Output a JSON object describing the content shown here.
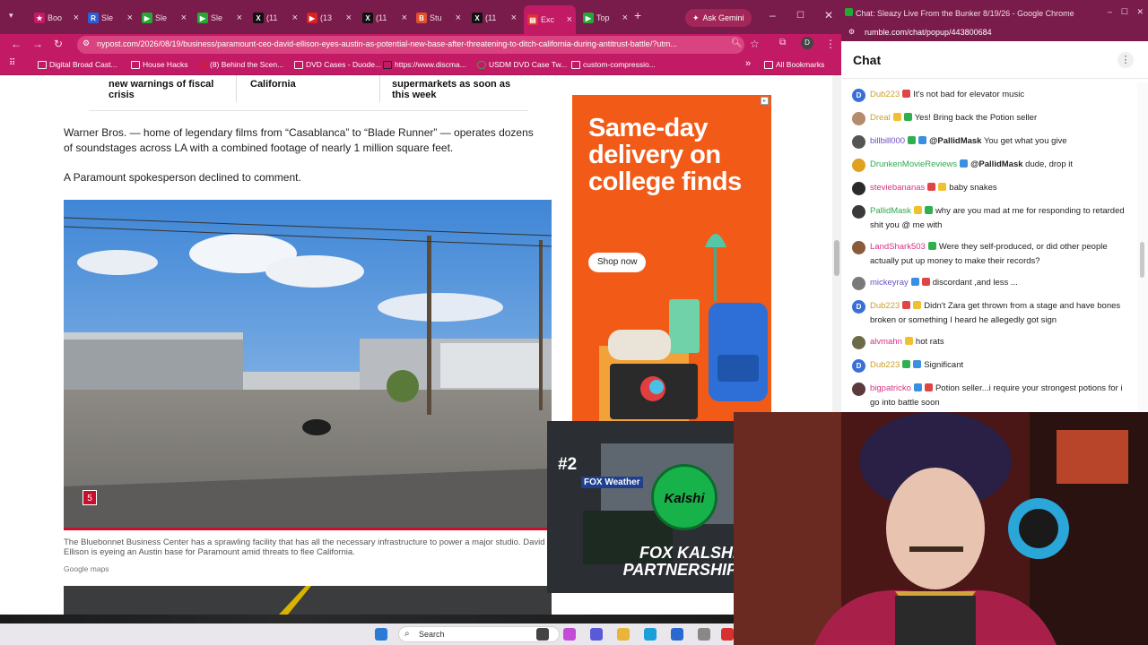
{
  "browser": {
    "tabs": [
      {
        "label": "Boo",
        "fav": "star",
        "color": "#c21a64"
      },
      {
        "label": "Sle",
        "fav": "R",
        "color": "#2b5fd9"
      },
      {
        "label": "Sle",
        "fav": "play",
        "color": "#22aa33"
      },
      {
        "label": "Sle",
        "fav": "play",
        "color": "#22aa33"
      },
      {
        "label": "(11",
        "fav": "X",
        "color": "#111"
      },
      {
        "label": "(13",
        "fav": "yt",
        "color": "#e02020"
      },
      {
        "label": "(11",
        "fav": "X",
        "color": "#111"
      },
      {
        "label": "Stu",
        "fav": "B",
        "color": "#e0502a"
      },
      {
        "label": "(11",
        "fav": "X",
        "color": "#111"
      },
      {
        "label": "Exc",
        "fav": "doc",
        "color": "#d33"
      },
      {
        "label": "Top",
        "fav": "play",
        "color": "#22aa33"
      }
    ],
    "ask_gemini": "Ask Gemini",
    "url": "nypost.com/2026/08/19/business/paramount-ceo-david-ellison-eyes-austin-as-potential-new-base-after-threatening-to-ditch-california-during-antitrust-battle/?utm...",
    "bookmarks": [
      "Digital Broad Cast...",
      "House Hacks",
      "(8) Behind the Scen...",
      "DVD Cases - Duode...",
      "https://www.discma...",
      "USDM DVD Case Tw...",
      "custom-compressio..."
    ],
    "all_bookmarks": "All Bookmarks"
  },
  "article": {
    "related": [
      "new warnings of fiscal crisis",
      "California",
      "supermarkets as soon as this week"
    ],
    "para1": "Warner Bros. — home of legendary films from “Casablanca” to “Blade Runner” — operates dozens of soundstages across LA with a combined footage of nearly 1 million square feet.",
    "para2": "A Paramount spokesperson declined to comment.",
    "slide_number": "5",
    "caption": "The Bluebonnet Business Center has a sprawling facility that has all the necessary infrastructure to power a major studio. David Ellison is eyeing an Austin base for Paramount amid threats to flee California.",
    "credit": "Google maps"
  },
  "ad": {
    "headline": "Same-day delivery on college finds",
    "cta": "Shop now"
  },
  "chat": {
    "window_title": "Chat: Sleazy Live From the Bunker 8/19/26 - Google Chrome",
    "url": "rumble.com/chat/popup/443800684",
    "heading": "Chat",
    "messages": [
      {
        "user": "Dub223",
        "color": "#c9a227",
        "av": "D",
        "avc": "#3a6fd8",
        "mention": "",
        "text": "It's not bad for elevator music"
      },
      {
        "user": "Dreal",
        "color": "#c9a227",
        "av": "",
        "avc": "#b58b6a",
        "mention": "",
        "text": "Yes! Bring back the Potion seller"
      },
      {
        "user": "billbill000",
        "color": "#6a4fc6",
        "av": "",
        "avc": "#555",
        "mention": "@PallidMask",
        "text": "You get what you give"
      },
      {
        "user": "DrunkenMovieReviews",
        "color": "#2fa84f",
        "av": "",
        "avc": "#e0a020",
        "mention": "@PallidMask",
        "text": "dude, drop it"
      },
      {
        "user": "steviebananas",
        "color": "#d63384",
        "av": "",
        "avc": "#2a2a2a",
        "mention": "",
        "text": "baby snakes"
      },
      {
        "user": "PallidMask",
        "color": "#2fa84f",
        "av": "",
        "avc": "#3a3a3a",
        "mention": "",
        "text": "why are you mad at me for responding to retarded shit you @ me with"
      },
      {
        "user": "LandShark503",
        "color": "#d63384",
        "av": "",
        "avc": "#8a5a3a",
        "mention": "",
        "text": "Were they self-produced, or did other people actually put up money to make their records?"
      },
      {
        "user": "mickeyray",
        "color": "#6a4fc6",
        "av": "",
        "avc": "#7a7a7a",
        "mention": "",
        "text": "discordant ,and less ..."
      },
      {
        "user": "Dub223",
        "color": "#c9a227",
        "av": "D",
        "avc": "#3a6fd8",
        "mention": "",
        "text": "Didn't Zara get thrown from a stage and have bones broken or something I heard he allegedly got sign"
      },
      {
        "user": "alvmahn",
        "color": "#d63384",
        "av": "",
        "avc": "#6b6b4a",
        "mention": "",
        "text": "hot rats"
      },
      {
        "user": "Dub223",
        "color": "#c9a227",
        "av": "D",
        "avc": "#3a6fd8",
        "mention": "",
        "text": "Significant"
      },
      {
        "user": "bigpatricko",
        "color": "#d63384",
        "av": "",
        "avc": "#5a3a3a",
        "mention": "",
        "text": "Potion seller...i require your strongest potions for i go into battle soon"
      }
    ]
  },
  "overlay": {
    "rank": "#2",
    "weather_label": "FOX Weather",
    "kalshi": "Kalshi",
    "partner_text": "FOX KALSHI PARTNERSHIP"
  },
  "taskbar": {
    "search_placeholder": "Search"
  }
}
